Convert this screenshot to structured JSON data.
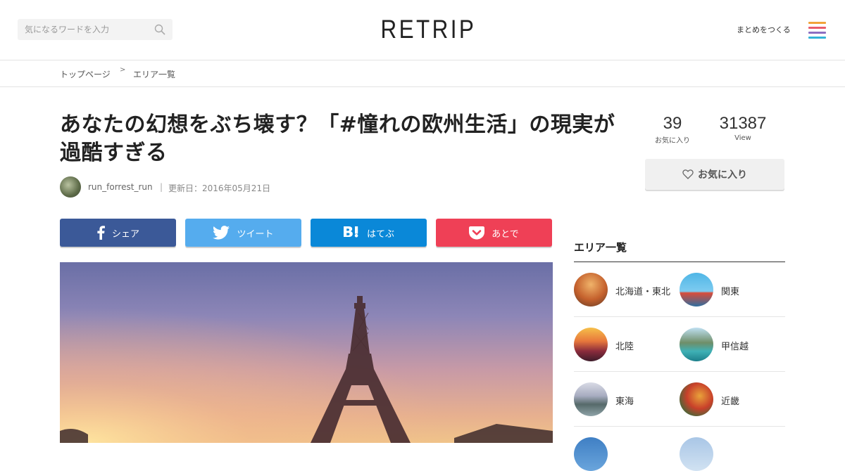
{
  "header": {
    "search_placeholder": "気になるワードを入力",
    "logo": "RETRIP",
    "create_link": "まとめをつくる",
    "menu_colors": [
      "#f2a33a",
      "#e95c6b",
      "#8c6fc2",
      "#33b3d8"
    ]
  },
  "breadcrumb": {
    "items": [
      "トップページ",
      "エリア一覧"
    ],
    "separator": ">"
  },
  "article": {
    "title": "あなたの幻想をぶち壊す？「#憧れの欧州生活」の現実が過酷すぎる",
    "author": "run_forrest_run",
    "meta_separator": "|",
    "updated": "更新日：2016年05月21日"
  },
  "share": {
    "facebook": {
      "label": "シェア",
      "color": "#3b5998",
      "icon": "facebook-icon"
    },
    "twitter": {
      "label": "ツイート",
      "color": "#55acee",
      "icon": "twitter-icon"
    },
    "hatena": {
      "label": "はてぶ",
      "color": "#0a88d8",
      "icon": "hatena-bookmark-icon"
    },
    "pocket": {
      "label": "あとで",
      "color": "#ef4056",
      "icon": "pocket-icon"
    }
  },
  "stats": {
    "favorites_count": "39",
    "favorites_label": "お気に入り",
    "views_count": "31387",
    "views_label": "View"
  },
  "favorite_button": {
    "label": "お気に入り",
    "icon": "heart-icon"
  },
  "sidebar": {
    "area_title": "エリア一覧",
    "areas": [
      {
        "name": "北海道・東北"
      },
      {
        "name": "関東"
      },
      {
        "name": "北陸"
      },
      {
        "name": "甲信越"
      },
      {
        "name": "東海"
      },
      {
        "name": "近畿"
      }
    ]
  }
}
